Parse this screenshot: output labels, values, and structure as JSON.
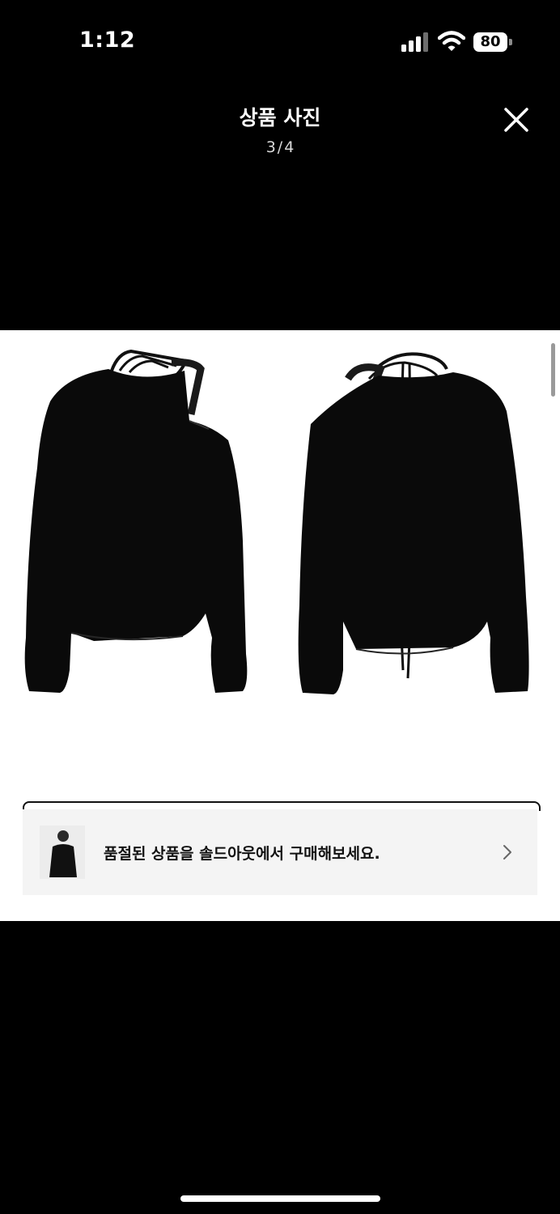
{
  "status_bar": {
    "time": "1:12",
    "battery_level": "80",
    "signal_icon": "cellular-signal-icon",
    "wifi_icon": "wifi-icon"
  },
  "viewer": {
    "title": "상품 사진",
    "current_index": "3",
    "separator": "/",
    "total": "4",
    "close_icon": "close-icon"
  },
  "banner": {
    "text": "품절된 상품을 솔드아웃에서 구매해보세요.",
    "chevron_icon": "chevron-right-icon"
  },
  "colors": {
    "background": "#000000",
    "photo_background": "#ffffff",
    "banner_background": "#f4f4f4",
    "garment": "#0a0a0a"
  }
}
